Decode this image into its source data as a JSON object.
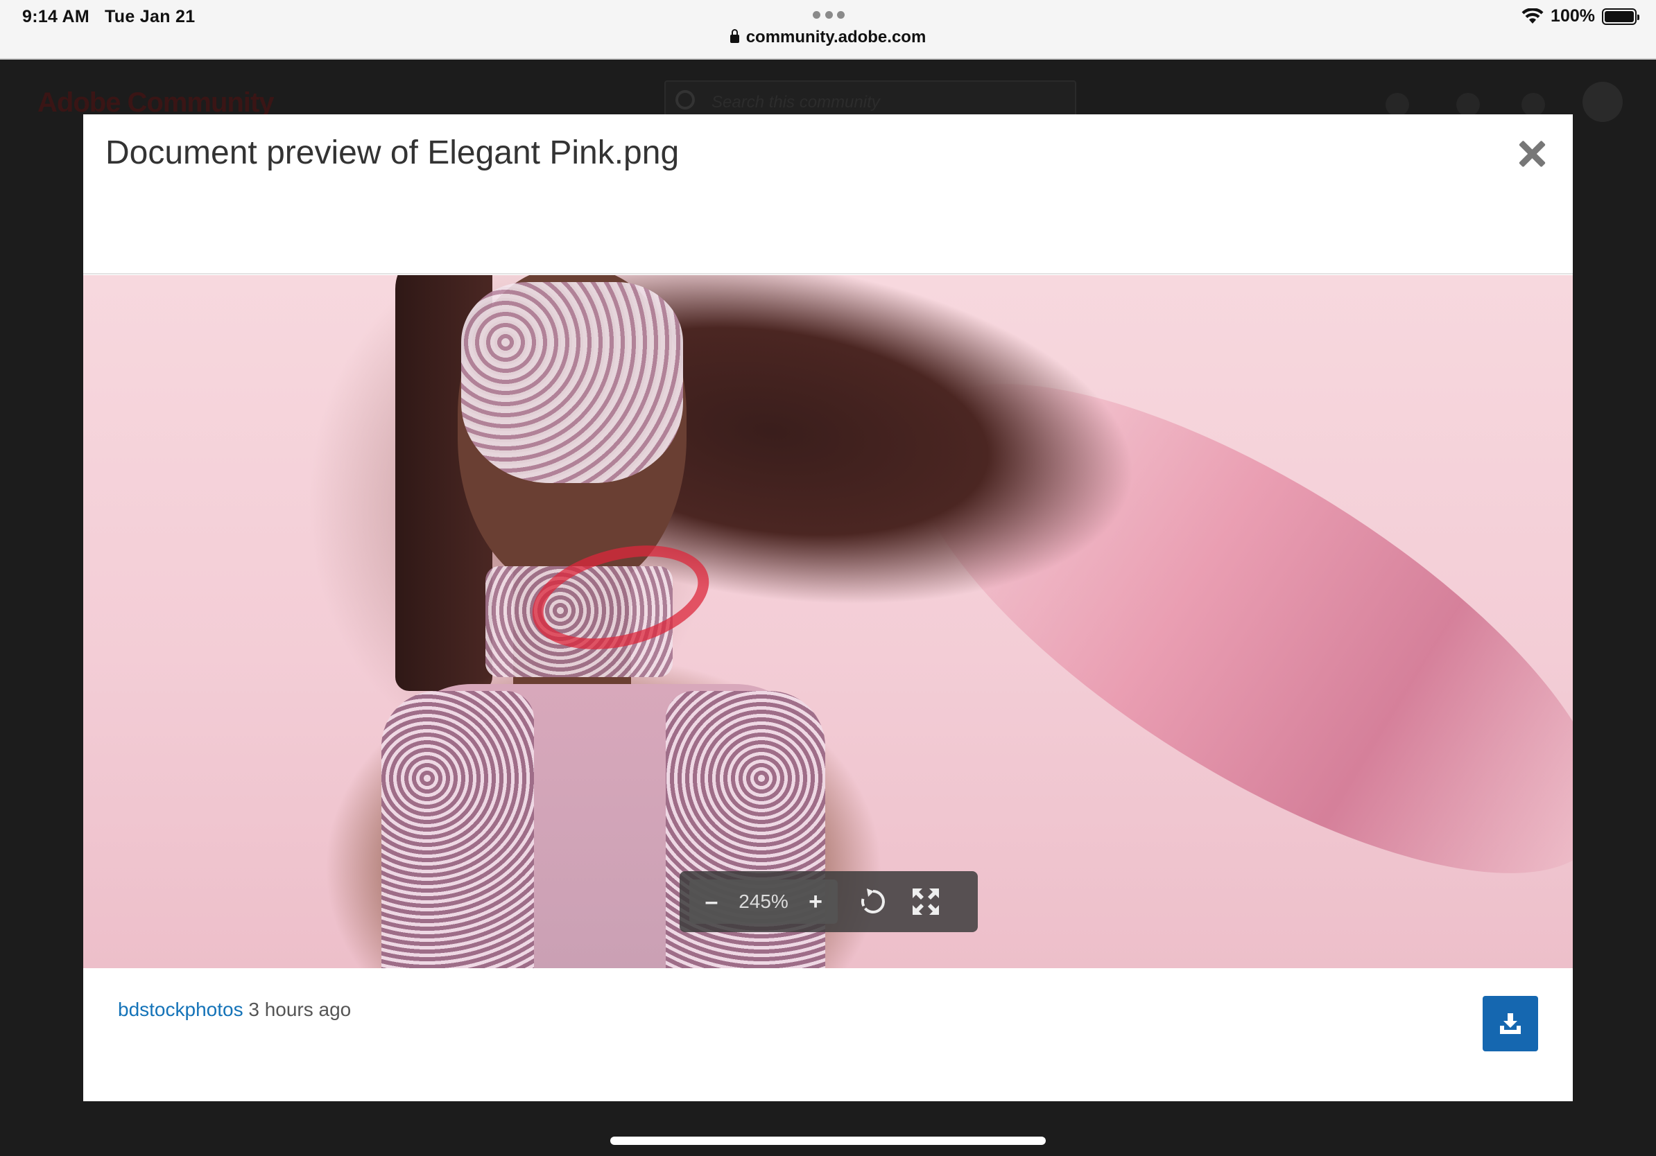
{
  "status_bar": {
    "time": "9:14 AM",
    "date": "Tue Jan 21",
    "url": "community.adobe.com",
    "battery": "100%"
  },
  "background_page": {
    "logo": "Adobe Community",
    "search_placeholder": "Search this community"
  },
  "modal": {
    "title": "Document preview of Elegant Pink.png",
    "zoom": {
      "decrease_label": "–",
      "level": "245%",
      "increase_label": "+"
    },
    "footer": {
      "author": "bdstockphotos",
      "time_ago": "3 hours ago"
    }
  },
  "colors": {
    "accent": "#1567b0",
    "link": "#1473b8",
    "annotation": "#dc283c"
  }
}
